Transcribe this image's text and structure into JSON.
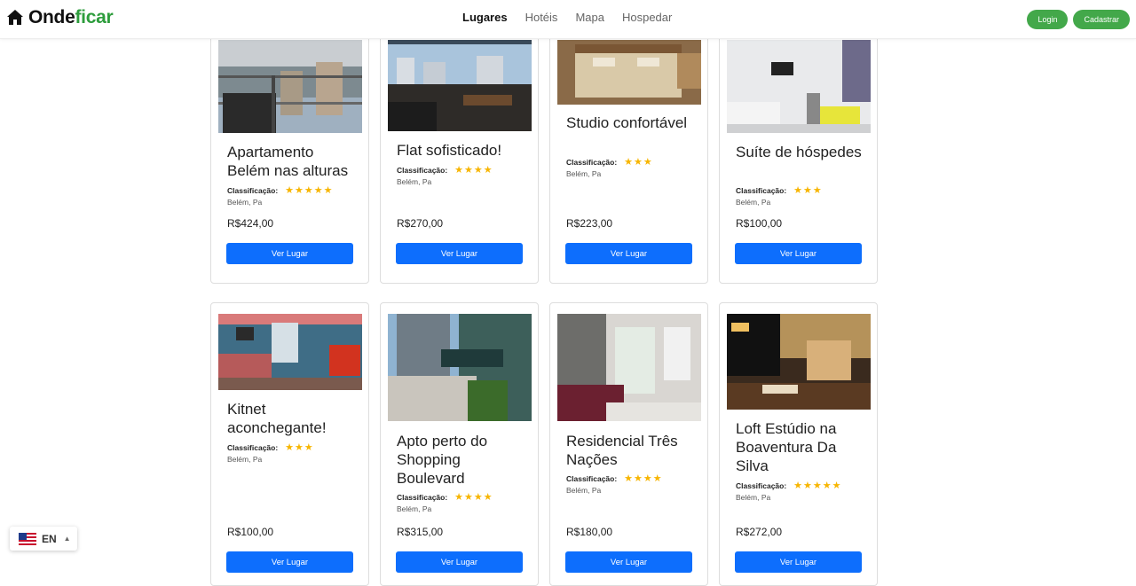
{
  "brand": {
    "name_part1": "Onde",
    "name_part2": "ficar",
    "icon": "home-icon"
  },
  "nav": {
    "items": [
      {
        "label": "Lugares",
        "active": true
      },
      {
        "label": "Hotéis",
        "active": false
      },
      {
        "label": "Mapa",
        "active": false
      },
      {
        "label": "Hospedar",
        "active": false
      }
    ]
  },
  "auth": {
    "login_label": "Login",
    "signup_label": "Cadastrar"
  },
  "colors": {
    "brand_green": "#2e9d3d",
    "button_blue": "#0d6efd",
    "star": "#f7b500",
    "auth_green": "#43a84a"
  },
  "rating_label": "Classificação:",
  "cta_label": "Ver Lugar",
  "listings": [
    {
      "title": "Apartamento Belém nas alturas",
      "stars": "★★★★★",
      "location": "Belém, Pa",
      "price": "R$424,00"
    },
    {
      "title": "Flat sofisticado!",
      "stars": "★★★★",
      "location": "Belém, Pa",
      "price": "R$270,00"
    },
    {
      "title": "Studio confortável",
      "stars": "★★★",
      "location": "Belém, Pa",
      "price": "R$223,00"
    },
    {
      "title": "Suíte de hóspedes",
      "stars": "★★★",
      "location": "Belém, Pa",
      "price": "R$100,00"
    },
    {
      "title": "Kitnet aconchegante!",
      "stars": "★★★",
      "location": "Belém, Pa",
      "price": "R$100,00"
    },
    {
      "title": "Apto perto do Shopping Boulevard",
      "stars": "★★★★",
      "location": "Belém, Pa",
      "price": "R$315,00"
    },
    {
      "title": "Residencial Três Nações",
      "stars": "★★★★",
      "location": "Belém, Pa",
      "price": "R$180,00"
    },
    {
      "title": "Loft Estúdio na Boaventura Da Silva",
      "stars": "★★★★★",
      "location": "Belém, Pa",
      "price": "R$272,00"
    }
  ],
  "language": {
    "code": "EN",
    "flag": "us-flag-icon"
  }
}
